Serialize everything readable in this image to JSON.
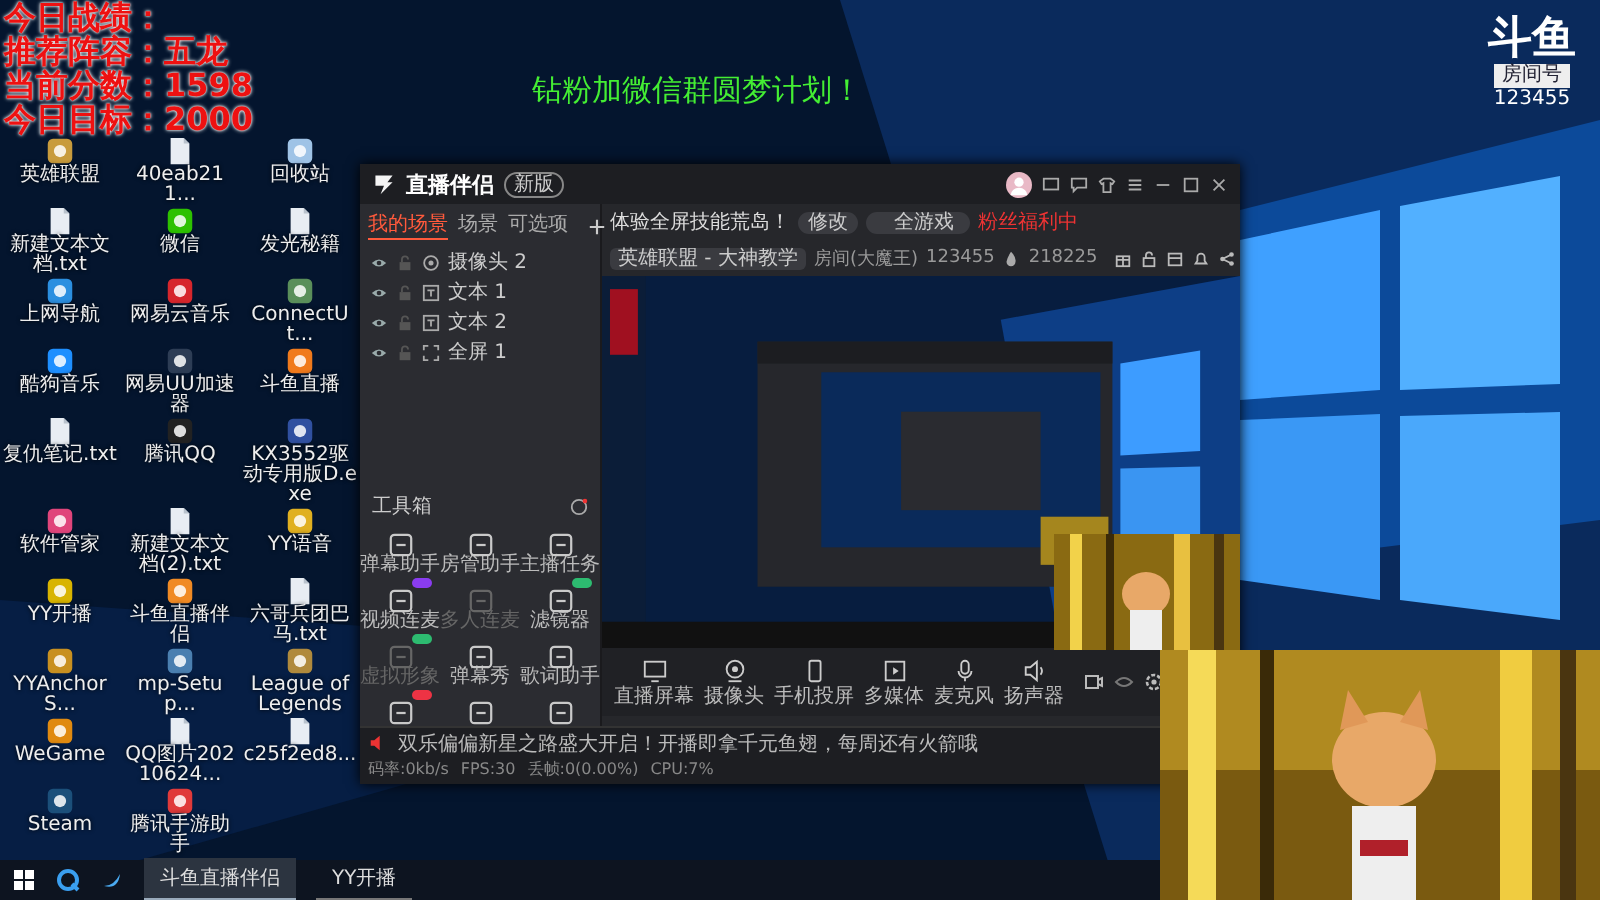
{
  "overlay": [
    "今日战绩：",
    "推荐阵容：五龙",
    "当前分数：1598",
    "今日目标：2000"
  ],
  "banner": "钻粉加微信群圆梦计划！",
  "room_logo": {
    "brand": "斗鱼",
    "label": "房间号",
    "number": "123455"
  },
  "desktop_icons": [
    {
      "label": "英雄联盟",
      "kind": "app",
      "color": "#c89b3c"
    },
    {
      "label": "40eab211...",
      "kind": "doc"
    },
    {
      "label": "回收站",
      "kind": "app",
      "color": "#9fc3e6"
    },
    {
      "label": "新建文本文档.txt",
      "kind": "doc"
    },
    {
      "label": "微信",
      "kind": "app",
      "color": "#2dc100"
    },
    {
      "label": "发光秘籍",
      "kind": "doc"
    },
    {
      "label": "上网导航",
      "kind": "app",
      "color": "#2b8fe0"
    },
    {
      "label": "网易云音乐",
      "kind": "app",
      "color": "#d6262c"
    },
    {
      "label": "ConnectUt...",
      "kind": "app",
      "color": "#5a8f5a"
    },
    {
      "label": "酷狗音乐",
      "kind": "app",
      "color": "#1e8fff"
    },
    {
      "label": "网易UU加速器",
      "kind": "app",
      "color": "#2d3d55"
    },
    {
      "label": "斗鱼直播",
      "kind": "app",
      "color": "#f07a1c"
    },
    {
      "label": "复仇笔记.txt",
      "kind": "doc"
    },
    {
      "label": "腾讯QQ",
      "kind": "app",
      "color": "#222222"
    },
    {
      "label": "KX3552驱动专用版D.exe",
      "kind": "app",
      "color": "#3050a0"
    },
    {
      "label": "软件管家",
      "kind": "app",
      "color": "#e0457b"
    },
    {
      "label": "新建文本文档(2).txt",
      "kind": "doc"
    },
    {
      "label": "YY语音",
      "kind": "app",
      "color": "#e0b020"
    },
    {
      "label": "YY开播",
      "kind": "app",
      "color": "#d8b400"
    },
    {
      "label": "斗鱼直播伴侣",
      "kind": "app",
      "color": "#f08a24"
    },
    {
      "label": "六哥兵团巴马.txt",
      "kind": "doc"
    },
    {
      "label": "YYAnchorS...",
      "kind": "app",
      "color": "#c89020"
    },
    {
      "label": "mp-Setup...",
      "kind": "app",
      "color": "#4a7fb0"
    },
    {
      "label": "League of Legends",
      "kind": "app",
      "color": "#b08a3c"
    },
    {
      "label": "WeGame",
      "kind": "app",
      "color": "#e08a10"
    },
    {
      "label": "QQ图片20210624...",
      "kind": "doc"
    },
    {
      "label": "c25f2ed8...",
      "kind": "doc"
    },
    {
      "label": "Steam",
      "kind": "app",
      "color": "#1b4f7a"
    },
    {
      "label": "腾讯手游助手",
      "kind": "app",
      "color": "#e03a3a"
    }
  ],
  "app": {
    "title": "直播伴侣",
    "version_badge": "新版",
    "scene_tabs": [
      {
        "label": "我的场景",
        "selected": true
      },
      {
        "label": "场景",
        "selected": false
      },
      {
        "label": "可选项",
        "selected": false
      }
    ],
    "scenes": [
      {
        "kind": "camera",
        "label": "摄像头 2"
      },
      {
        "kind": "text",
        "label": "文本 1"
      },
      {
        "kind": "text",
        "label": "文本 2"
      },
      {
        "kind": "screen",
        "label": "全屏 1"
      }
    ],
    "toolbox_title": "工具箱",
    "tools": [
      {
        "label": "弹幕助手",
        "disabled": false
      },
      {
        "label": "房管助手",
        "disabled": false
      },
      {
        "label": "主播任务",
        "disabled": false
      },
      {
        "label": "视频连麦",
        "disabled": false,
        "badge": {
          "color": "#8a3cf0"
        }
      },
      {
        "label": "多人连麦",
        "disabled": true
      },
      {
        "label": "滤镜器",
        "disabled": false,
        "badge": {
          "color": "#2dbb70"
        }
      },
      {
        "label": "虚拟形象",
        "disabled": true,
        "badge": {
          "color": "#2dbb70"
        }
      },
      {
        "label": "弹幕秀",
        "disabled": false
      },
      {
        "label": "歌词助手",
        "disabled": false
      },
      {
        "disabled": false,
        "badge": {
          "color": "#ee3344"
        }
      },
      {
        "disabled": false
      },
      {
        "disabled": false
      }
    ],
    "room_title": "体验全屏技能荒岛！",
    "edit_button": "修改",
    "category": "全游戏",
    "live_status": "粉丝福利中",
    "game": "英雄联盟 - 大神教学",
    "room_label": "房间(大魔王)",
    "room_id": "123455",
    "popularity": "218225",
    "controls": [
      {
        "kind": "screen",
        "label": "直播屏幕"
      },
      {
        "kind": "camera",
        "label": "摄像头"
      },
      {
        "kind": "phone",
        "label": "手机投屏"
      },
      {
        "kind": "media",
        "label": "多媒体"
      },
      {
        "kind": "mic",
        "label": "麦克风"
      },
      {
        "kind": "speaker",
        "label": "扬声器"
      }
    ],
    "notice": "双乐偏偏新星之路盛大开启！开播即拿千元鱼翅，每周还有火箭哦",
    "stats": [
      "码率:0kb/s",
      "FPS:30",
      "丢帧:0(0.00%)",
      "CPU:7%"
    ]
  },
  "taskbar": [
    {
      "label": "斗鱼直播伴侣",
      "selected": true
    },
    {
      "label": "YY开播",
      "selected": false
    }
  ]
}
